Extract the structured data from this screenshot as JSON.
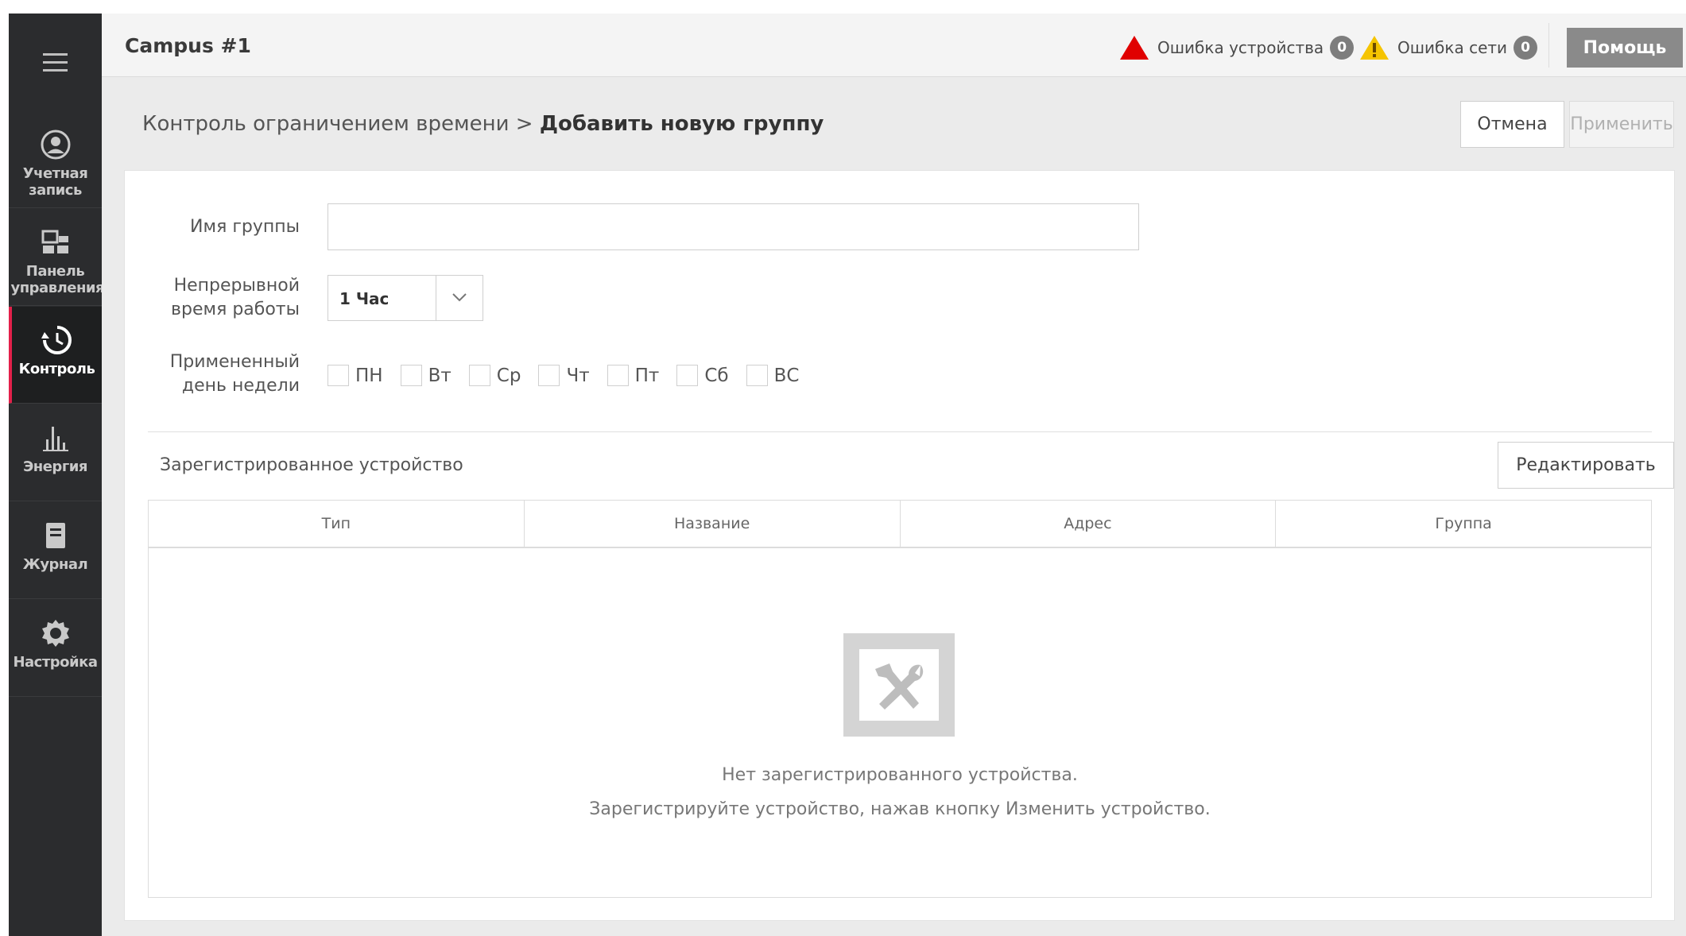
{
  "header": {
    "title": "Campus #1",
    "device_error_label": "Ошибка устройства",
    "device_error_count": "0",
    "network_error_label": "Ошибка сети",
    "network_error_count": "0",
    "help_label": "Помощь",
    "colors": {
      "device_error": "#e00000",
      "network_error": "#f5c400",
      "help_bg": "#8a8a8a"
    }
  },
  "sidebar": {
    "menu_icon": "hamburger-icon",
    "active_color": "#e3204a",
    "items": [
      {
        "label": "Учетная запись",
        "icon": "user-icon"
      },
      {
        "label": "Панель управления",
        "icon": "dashboard-icon"
      },
      {
        "label": "Контроль",
        "icon": "control-icon"
      },
      {
        "label": "Энергия",
        "icon": "energy-chart-icon"
      },
      {
        "label": "Журнал",
        "icon": "journal-icon"
      },
      {
        "label": "Настройка",
        "icon": "gear-icon"
      }
    ]
  },
  "page": {
    "breadcrumb_parent": "Контроль ограничением времени",
    "breadcrumb_sep": ">",
    "breadcrumb_current": "Добавить новую группу",
    "cancel_label": "Отмена",
    "apply_label": "Применить"
  },
  "form": {
    "group_name_label": "Имя группы",
    "group_name_value": "",
    "runtime_label_line1": "Непрерывной",
    "runtime_label_line2": "время работы",
    "runtime_value": "1 Час",
    "days_label_line1": "Примененный",
    "days_label_line2": "день недели",
    "days": [
      "ПН",
      "Вт",
      "Ср",
      "Чт",
      "Пт",
      "Сб",
      "ВС"
    ]
  },
  "devices": {
    "title": "Зарегистрированное устройство",
    "edit_label": "Редактировать",
    "columns": [
      "Тип",
      "Название",
      "Адрес",
      "Группа"
    ],
    "empty_line1": "Нет зарегистрированного устройства.",
    "empty_line2": "Зарегистрируйте устройство, нажав кнопку Изменить устройство."
  }
}
